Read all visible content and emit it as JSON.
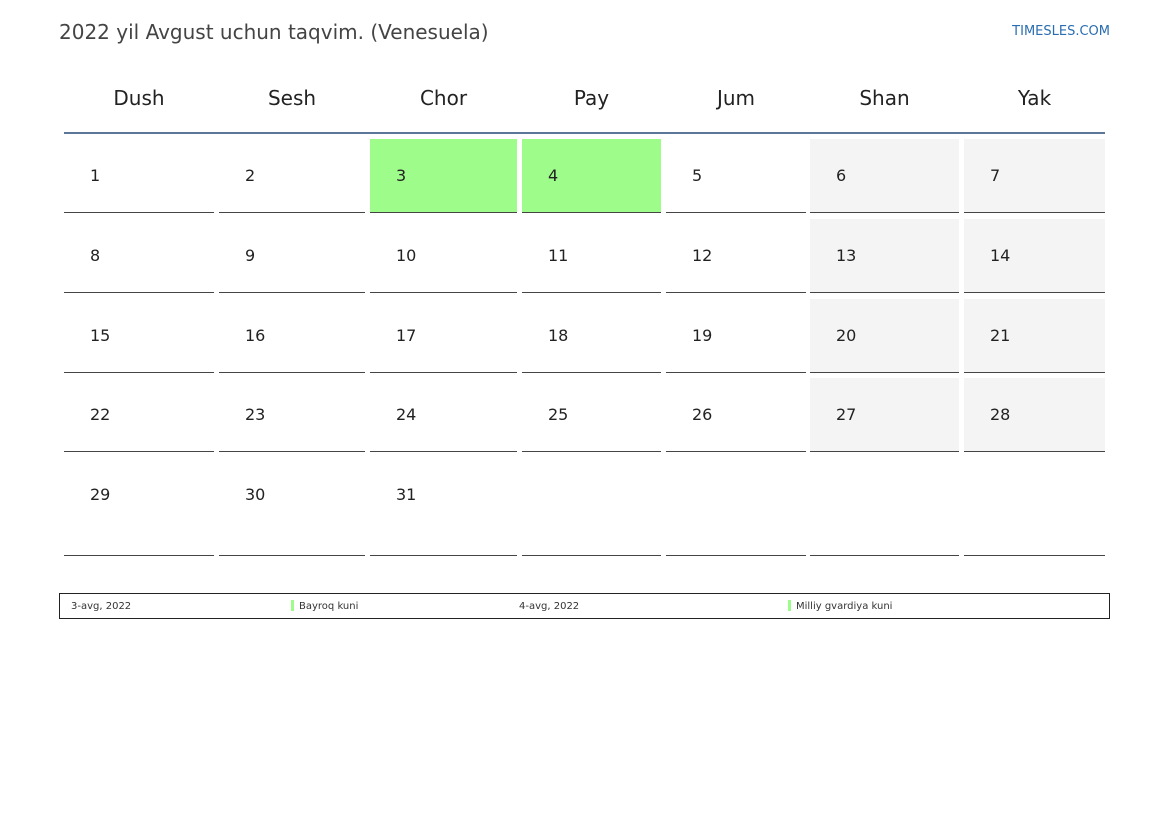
{
  "header": {
    "title": "2022 yil Avgust uchun taqvim. (Venesuela)",
    "site": "TIMESLES.COM"
  },
  "colors": {
    "holiday": "#9efc8a",
    "weekend": "#f4f4f4",
    "header_rule": "#5a7698",
    "link": "#2a6db0"
  },
  "calendar": {
    "weekdays": [
      "Dush",
      "Sesh",
      "Chor",
      "Pay",
      "Jum",
      "Shan",
      "Yak"
    ],
    "weeks": [
      [
        "1",
        "2",
        "3",
        "4",
        "5",
        "6",
        "7"
      ],
      [
        "8",
        "9",
        "10",
        "11",
        "12",
        "13",
        "14"
      ],
      [
        "15",
        "16",
        "17",
        "18",
        "19",
        "20",
        "21"
      ],
      [
        "22",
        "23",
        "24",
        "25",
        "26",
        "27",
        "28"
      ],
      [
        "29",
        "30",
        "31",
        "",
        "",
        "",
        ""
      ]
    ],
    "holiday_days": [
      "3",
      "4"
    ]
  },
  "legend": {
    "items": [
      {
        "date": "3-avg, 2022",
        "name": "Bayroq kuni"
      },
      {
        "date": "4-avg, 2022",
        "name": "Milliy gvardiya kuni"
      }
    ]
  }
}
